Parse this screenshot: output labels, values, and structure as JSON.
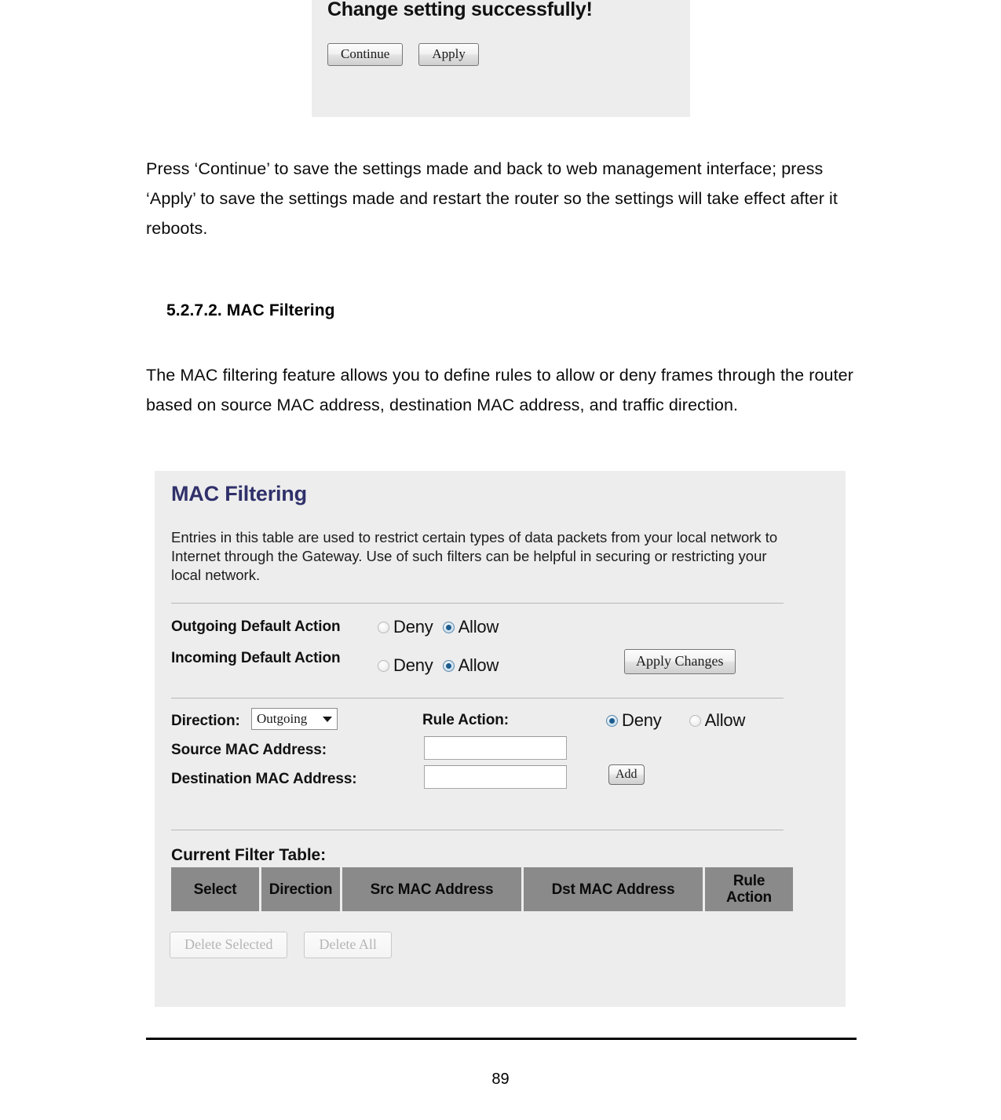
{
  "document": {
    "paragraph_1": "Press ‘Continue’ to save the settings made and back to web management interface; press ‘Apply’ to save the settings made and restart the router so the settings will take effect after it reboots.",
    "section_heading": "5.2.7.2. MAC Filtering",
    "paragraph_2": "The MAC filtering feature allows you to define rules to allow or deny frames through the router based on source MAC address, destination MAC address, and traffic direction.",
    "page_number": "89"
  },
  "top_screenshot": {
    "title": "Change setting successfully!",
    "continue_button": "Continue",
    "apply_button": "Apply"
  },
  "mac_filtering": {
    "title": "MAC Filtering",
    "title_color": "#30306b",
    "description": "Entries in this table are used to restrict certain types of data packets from your local network to Internet through the Gateway. Use of such filters can be helpful in securing or restricting your local network.",
    "outgoing_default_action_label": "Outgoing Default Action",
    "incoming_default_action_label": "Incoming Default Action",
    "outgoing_default_action": {
      "deny_label": "Deny",
      "allow_label": "Allow",
      "selected": "Allow"
    },
    "incoming_default_action": {
      "deny_label": "Deny",
      "allow_label": "Allow",
      "selected": "Allow"
    },
    "apply_changes_button": "Apply Changes",
    "direction_label": "Direction:",
    "direction_value": "Outgoing",
    "source_mac_label": "Source MAC Address:",
    "source_mac_value": "",
    "destination_mac_label": "Destination MAC Address:",
    "destination_mac_value": "",
    "rule_action_label": "Rule Action:",
    "rule_action": {
      "deny_label": "Deny",
      "allow_label": "Allow",
      "selected": "Deny"
    },
    "add_button": "Add",
    "current_filter_table_label": "Current Filter Table:",
    "table": {
      "headers": [
        "Select",
        "Direction",
        "Src MAC Address",
        "Dst MAC Address",
        "Rule Action"
      ],
      "header_bg": "#8a8a8a",
      "rows": []
    },
    "delete_selected_button": "Delete Selected",
    "delete_all_button": "Delete All",
    "panel_bg": "#ededed"
  }
}
